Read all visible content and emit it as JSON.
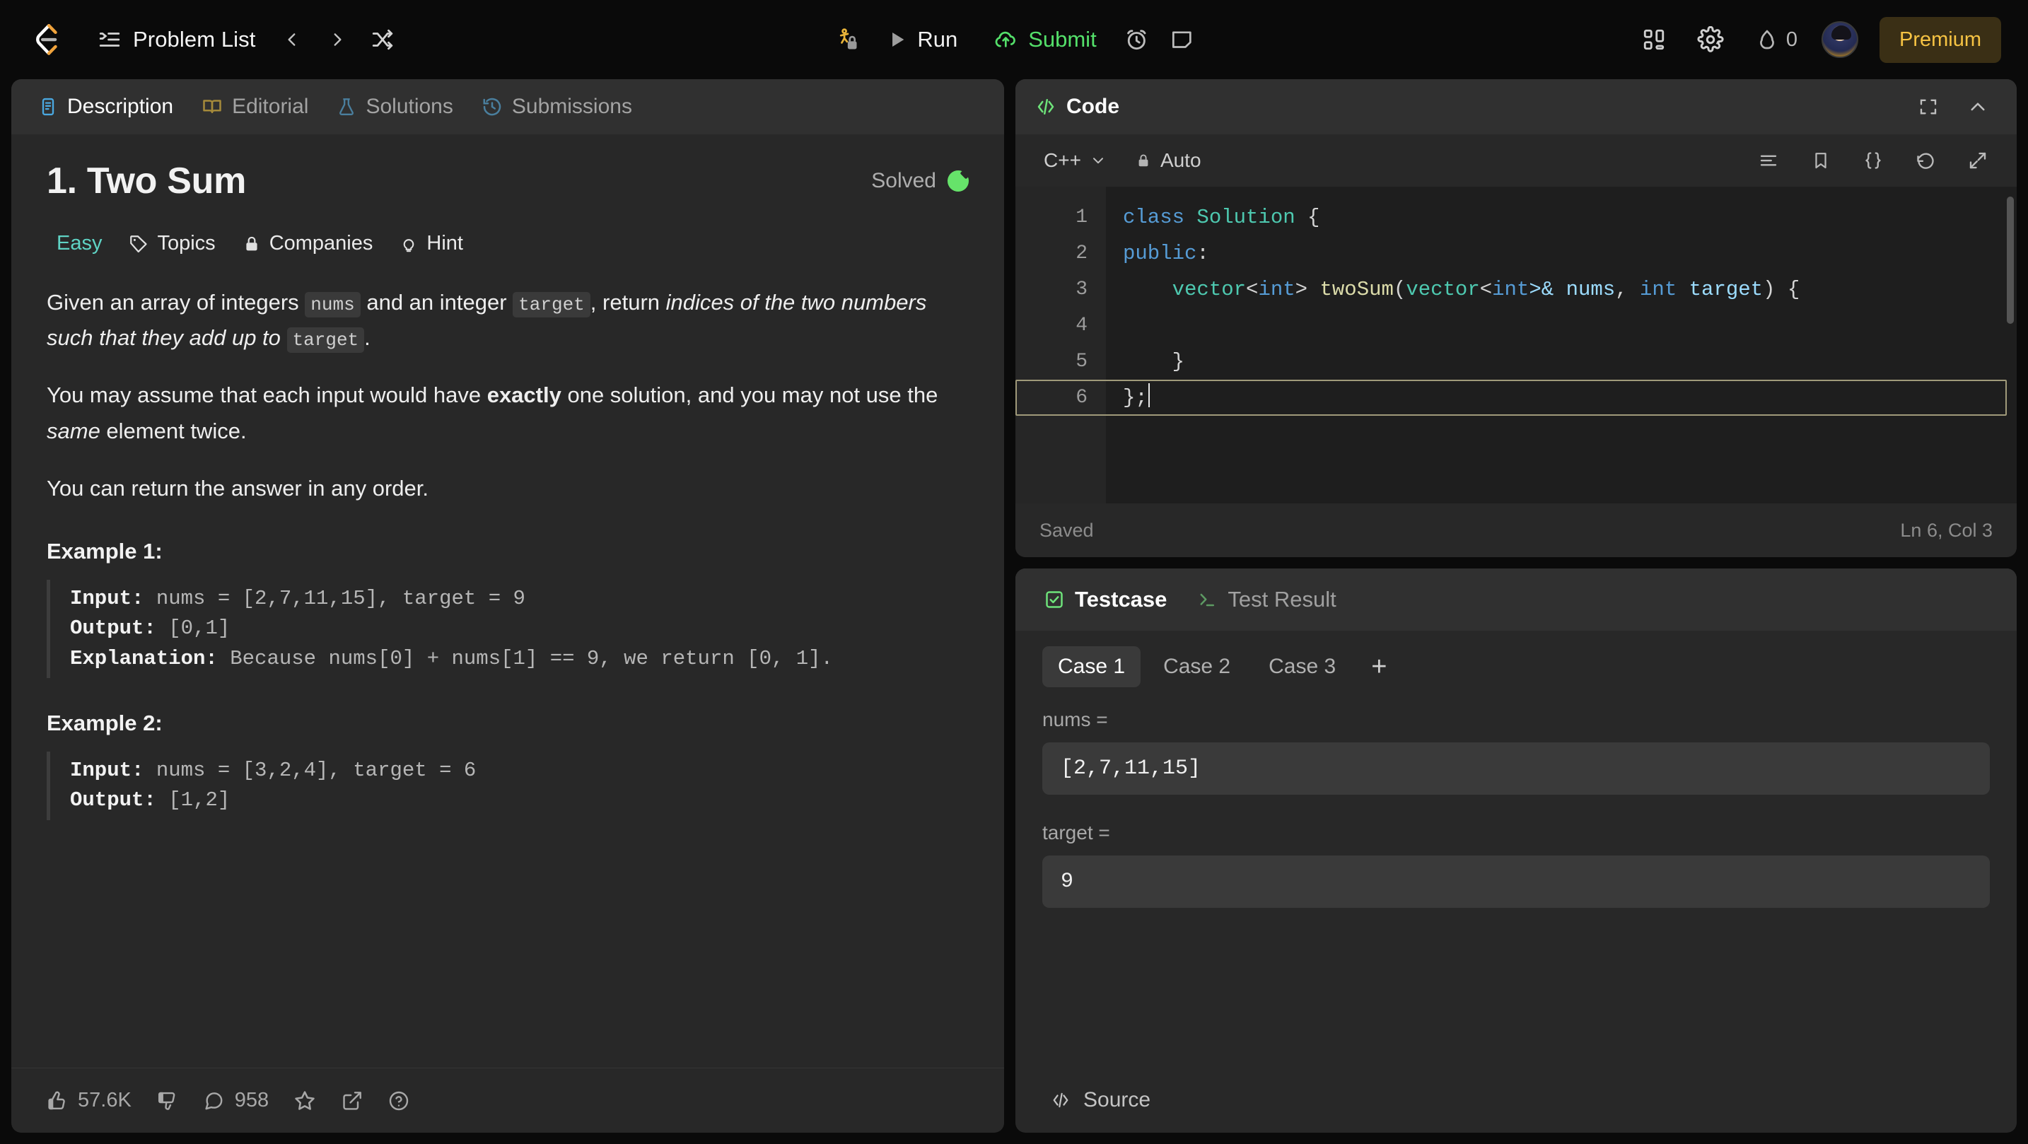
{
  "header": {
    "logo_icon": "leetcode-logo-icon",
    "problem_list_label": "Problem List",
    "problem_list_icon": "list-icon",
    "prev_icon": "chevron-left-icon",
    "next_icon": "chevron-right-icon",
    "shuffle_icon": "shuffle-icon",
    "daily_icon": "daily-challenge-lock-icon",
    "run_label": "Run",
    "run_icon": "play-icon",
    "submit_label": "Submit",
    "submit_icon": "cloud-upload-icon",
    "timer_icon": "alarm-clock-icon",
    "note_icon": "note-icon",
    "layout_icon": "layout-grid-icon",
    "settings_icon": "gear-icon",
    "streak_icon": "flame-icon",
    "streak_count": "0",
    "avatar_icon": "user-avatar",
    "premium_label": "Premium",
    "accent_green": "#54e06a",
    "accent_gold": "#f6c343",
    "logo_orange": "#f0a33c"
  },
  "left_panel": {
    "tabs": [
      {
        "label": "Description",
        "icon": "description-icon",
        "active": true
      },
      {
        "label": "Editorial",
        "icon": "book-icon",
        "active": false
      },
      {
        "label": "Solutions",
        "icon": "flask-icon",
        "active": false
      },
      {
        "label": "Submissions",
        "icon": "history-icon",
        "active": false
      }
    ],
    "title": "1. Two Sum",
    "solved_label": "Solved",
    "solved_color": "#66e36a",
    "meta": [
      {
        "label": "Easy",
        "icon": "",
        "color": "#5fd3c4"
      },
      {
        "label": "Topics",
        "icon": "tag-icon",
        "color": "#eaeaea"
      },
      {
        "label": "Companies",
        "icon": "lock-icon",
        "color": "#eaeaea"
      },
      {
        "label": "Hint",
        "icon": "bulb-icon",
        "color": "#eaeaea"
      }
    ],
    "description": {
      "p1_a": "Given an array of integers ",
      "p1_code1": "nums",
      "p1_b": " and an integer ",
      "p1_code2": "target",
      "p1_c": ", return ",
      "p1_em": "indices of the two numbers such that they add up to ",
      "p1_code3": "target",
      "p1_d": ".",
      "p2_a": "You may assume that each input would have ",
      "p2_bold": "exactly",
      "p2_b": " one solution, and you may not use the ",
      "p2_em": "same",
      "p2_c": " element twice.",
      "p3": "You can return the answer in any order."
    },
    "examples": [
      {
        "heading": "Example 1:",
        "input_label": "Input:",
        "input_value": " nums = [2,7,11,15], target = 9",
        "output_label": "Output:",
        "output_value": " [0,1]",
        "explanation_label": "Explanation:",
        "explanation_value": " Because nums[0] + nums[1] == 9, we return [0, 1]."
      },
      {
        "heading": "Example 2:",
        "input_label": "Input:",
        "input_value": " nums = [3,2,4], target = 6",
        "output_label": "Output:",
        "output_value": " [1,2]",
        "explanation_label": "",
        "explanation_value": ""
      }
    ],
    "footer": {
      "like_icon": "thumbs-up-icon",
      "like_count": "57.6K",
      "dislike_icon": "thumbs-down-icon",
      "comment_icon": "comment-icon",
      "comment_count": "958",
      "star_icon": "star-icon",
      "share_icon": "share-external-icon",
      "help_icon": "question-circle-icon"
    }
  },
  "code_panel": {
    "title": "Code",
    "title_icon": "code-brackets-icon",
    "fullscreen_icon": "fullscreen-icon",
    "collapse_icon": "chevron-up-icon",
    "language": "C++",
    "language_caret_icon": "chevron-down-icon",
    "auto_label": "Auto",
    "auto_icon": "lock-icon",
    "toolbar_icons": [
      "format-lines-icon",
      "bookmark-icon",
      "curly-braces-icon",
      "reset-undo-icon",
      "expand-diagonal-icon"
    ],
    "lines": [
      {
        "n": "1",
        "tokens": [
          {
            "t": "class ",
            "c": "kw"
          },
          {
            "t": "Solution",
            "c": "ty"
          },
          {
            "t": " {",
            "c": "pl"
          }
        ]
      },
      {
        "n": "2",
        "tokens": [
          {
            "t": "public",
            "c": "kw"
          },
          {
            "t": ":",
            "c": "pl"
          }
        ]
      },
      {
        "n": "3",
        "tokens": [
          {
            "t": "    ",
            "c": "pl"
          },
          {
            "t": "vector",
            "c": "ty"
          },
          {
            "t": "<",
            "c": "pl"
          },
          {
            "t": "int",
            "c": "kw"
          },
          {
            "t": "> ",
            "c": "pl"
          },
          {
            "t": "twoSum",
            "c": "fn"
          },
          {
            "t": "(",
            "c": "pl"
          },
          {
            "t": "vector",
            "c": "ty"
          },
          {
            "t": "<",
            "c": "pl"
          },
          {
            "t": "int",
            "c": "kw"
          },
          {
            "t": ">& ",
            "c": "pn"
          },
          {
            "t": "nums",
            "c": "pn"
          },
          {
            "t": ", ",
            "c": "pl"
          },
          {
            "t": "int ",
            "c": "kw"
          },
          {
            "t": "target",
            "c": "pn"
          },
          {
            "t": ") {",
            "c": "pl"
          }
        ]
      },
      {
        "n": "4",
        "tokens": [
          {
            "t": "        ",
            "c": "pl"
          }
        ]
      },
      {
        "n": "5",
        "tokens": [
          {
            "t": "    }",
            "c": "pl"
          }
        ]
      },
      {
        "n": "6",
        "tokens": [
          {
            "t": "};",
            "c": "pl"
          }
        ]
      }
    ],
    "cursor_line": 6,
    "status_saved": "Saved",
    "status_position": "Ln 6, Col 3"
  },
  "test_panel": {
    "tabs": [
      {
        "label": "Testcase",
        "icon": "checkbox-icon",
        "active": true
      },
      {
        "label": "Test Result",
        "icon": "terminal-icon",
        "active": false
      }
    ],
    "cases": [
      {
        "label": "Case 1",
        "active": true
      },
      {
        "label": "Case 2",
        "active": false
      },
      {
        "label": "Case 3",
        "active": false
      }
    ],
    "add_case_icon": "plus-icon",
    "fields": [
      {
        "label": "nums =",
        "value": "[2,7,11,15]"
      },
      {
        "label": "target =",
        "value": "9"
      }
    ],
    "source_label": "Source",
    "source_icon": "code-brackets-icon"
  }
}
